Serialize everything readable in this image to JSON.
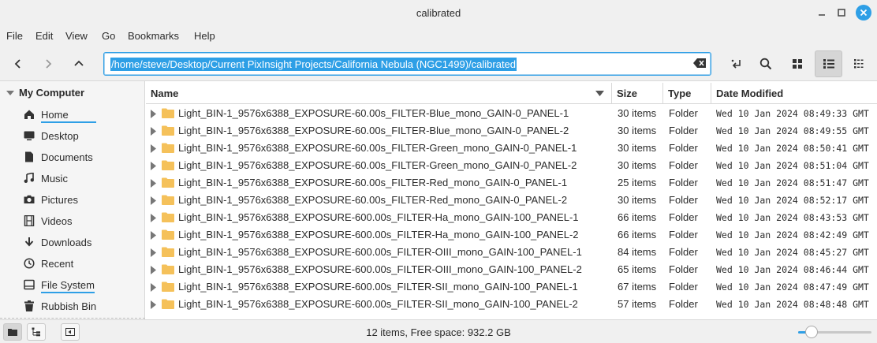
{
  "window": {
    "title": "calibrated"
  },
  "menu": [
    "File",
    "Edit",
    "View",
    "Go",
    "Bookmarks",
    "Help"
  ],
  "toolbar": {
    "address": "/home/steve/Desktop/Current PixInsight Projects/California Nebula (NGC1499)/calibrated",
    "active_view": "list"
  },
  "sidebar": {
    "header": "My Computer",
    "items": [
      {
        "label": "Home",
        "icon": "home-icon",
        "underlined": true
      },
      {
        "label": "Desktop",
        "icon": "desktop-icon",
        "underlined": false
      },
      {
        "label": "Documents",
        "icon": "document-icon",
        "underlined": false
      },
      {
        "label": "Music",
        "icon": "music-icon",
        "underlined": false
      },
      {
        "label": "Pictures",
        "icon": "camera-icon",
        "underlined": false
      },
      {
        "label": "Videos",
        "icon": "film-icon",
        "underlined": false
      },
      {
        "label": "Downloads",
        "icon": "download-icon",
        "underlined": false
      },
      {
        "label": "Recent",
        "icon": "clock-icon",
        "underlined": false
      },
      {
        "label": "File System",
        "icon": "drive-icon",
        "underlined": true
      },
      {
        "label": "Rubbish Bin",
        "icon": "trash-icon",
        "underlined": false
      }
    ]
  },
  "columns": {
    "name": "Name",
    "size": "Size",
    "type": "Type",
    "date": "Date Modified"
  },
  "files": [
    {
      "name": "Light_BIN-1_9576x6388_EXPOSURE-60.00s_FILTER-Blue_mono_GAIN-0_PANEL-1",
      "size": "30 items",
      "type": "Folder",
      "date": "Wed 10 Jan 2024 08:49:33 GMT"
    },
    {
      "name": "Light_BIN-1_9576x6388_EXPOSURE-60.00s_FILTER-Blue_mono_GAIN-0_PANEL-2",
      "size": "30 items",
      "type": "Folder",
      "date": "Wed 10 Jan 2024 08:49:55 GMT"
    },
    {
      "name": "Light_BIN-1_9576x6388_EXPOSURE-60.00s_FILTER-Green_mono_GAIN-0_PANEL-1",
      "size": "30 items",
      "type": "Folder",
      "date": "Wed 10 Jan 2024 08:50:41 GMT"
    },
    {
      "name": "Light_BIN-1_9576x6388_EXPOSURE-60.00s_FILTER-Green_mono_GAIN-0_PANEL-2",
      "size": "30 items",
      "type": "Folder",
      "date": "Wed 10 Jan 2024 08:51:04 GMT"
    },
    {
      "name": "Light_BIN-1_9576x6388_EXPOSURE-60.00s_FILTER-Red_mono_GAIN-0_PANEL-1",
      "size": "25 items",
      "type": "Folder",
      "date": "Wed 10 Jan 2024 08:51:47 GMT"
    },
    {
      "name": "Light_BIN-1_9576x6388_EXPOSURE-60.00s_FILTER-Red_mono_GAIN-0_PANEL-2",
      "size": "30 items",
      "type": "Folder",
      "date": "Wed 10 Jan 2024 08:52:17 GMT"
    },
    {
      "name": "Light_BIN-1_9576x6388_EXPOSURE-600.00s_FILTER-Ha_mono_GAIN-100_PANEL-1",
      "size": "66 items",
      "type": "Folder",
      "date": "Wed 10 Jan 2024 08:43:53 GMT"
    },
    {
      "name": "Light_BIN-1_9576x6388_EXPOSURE-600.00s_FILTER-Ha_mono_GAIN-100_PANEL-2",
      "size": "66 items",
      "type": "Folder",
      "date": "Wed 10 Jan 2024 08:42:49 GMT"
    },
    {
      "name": "Light_BIN-1_9576x6388_EXPOSURE-600.00s_FILTER-OIII_mono_GAIN-100_PANEL-1",
      "size": "84 items",
      "type": "Folder",
      "date": "Wed 10 Jan 2024 08:45:27 GMT"
    },
    {
      "name": "Light_BIN-1_9576x6388_EXPOSURE-600.00s_FILTER-OIII_mono_GAIN-100_PANEL-2",
      "size": "65 items",
      "type": "Folder",
      "date": "Wed 10 Jan 2024 08:46:44 GMT"
    },
    {
      "name": "Light_BIN-1_9576x6388_EXPOSURE-600.00s_FILTER-SII_mono_GAIN-100_PANEL-1",
      "size": "67 items",
      "type": "Folder",
      "date": "Wed 10 Jan 2024 08:47:49 GMT"
    },
    {
      "name": "Light_BIN-1_9576x6388_EXPOSURE-600.00s_FILTER-SII_mono_GAIN-100_PANEL-2",
      "size": "57 items",
      "type": "Folder",
      "date": "Wed 10 Jan 2024 08:48:48 GMT"
    }
  ],
  "status": {
    "text": "12 items, Free space: 932.2 GB",
    "zoom_fraction": 0.18
  },
  "colors": {
    "accent": "#2e9fe6",
    "folder": "#f5c15a"
  }
}
